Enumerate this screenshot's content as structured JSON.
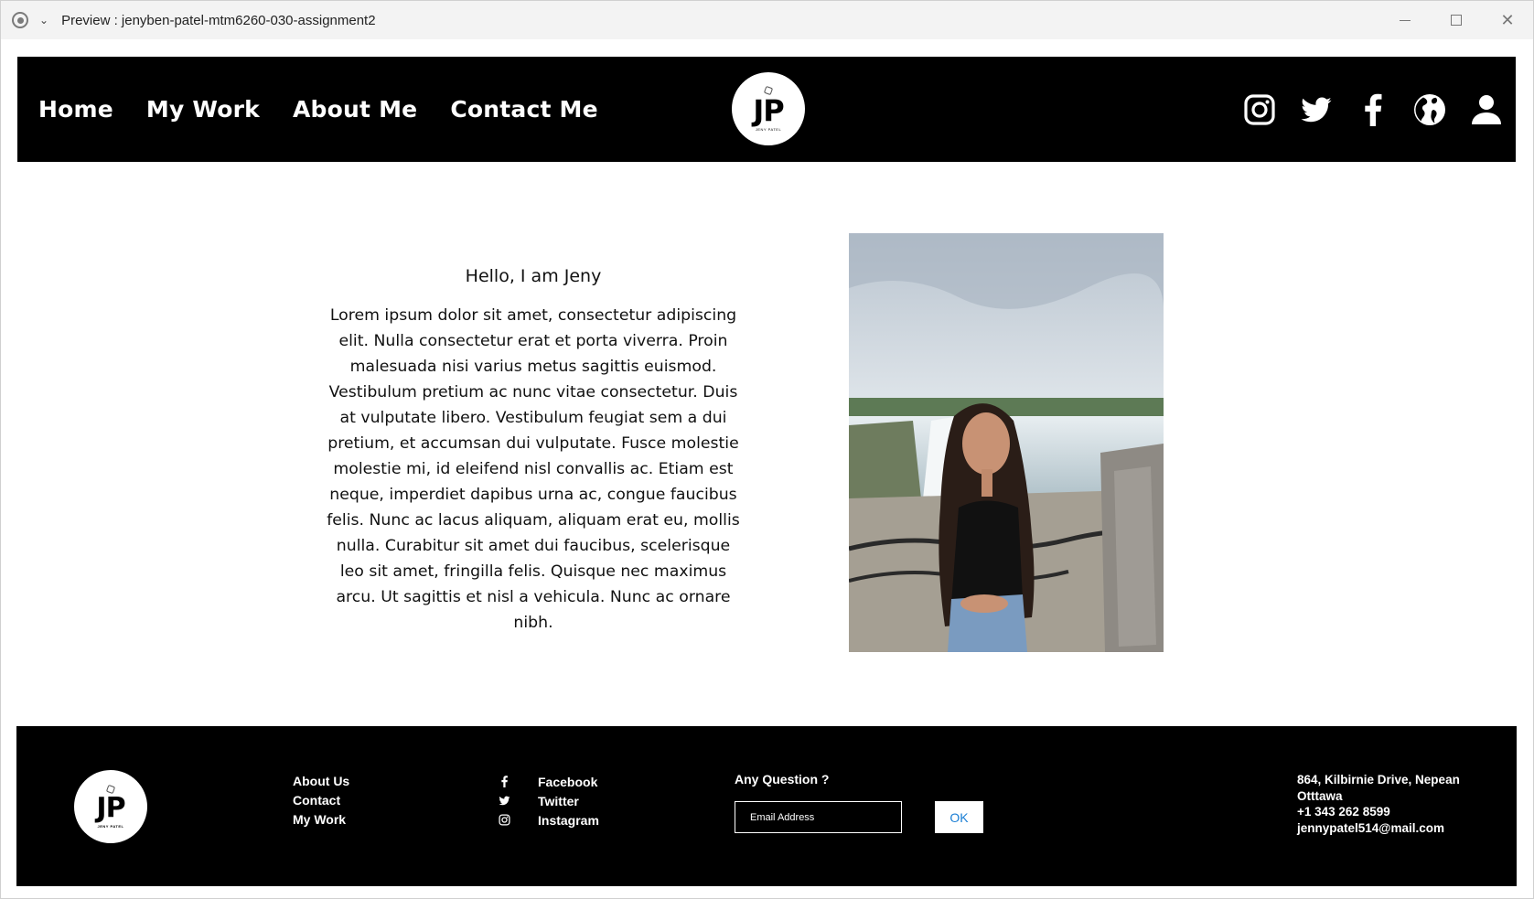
{
  "window": {
    "title": "Preview : jenyben-patel-mtm6260-030-assignment2"
  },
  "header": {
    "nav": [
      "Home",
      "My Work",
      "About Me",
      "Contact Me"
    ],
    "logo": {
      "initials": "JP",
      "subtitle": "JENY PATEL"
    },
    "social_icons": [
      "instagram-icon",
      "twitter-icon",
      "facebook-icon",
      "globe-icon",
      "user-icon"
    ]
  },
  "main": {
    "heading": "Hello, I am Jeny",
    "body": "Lorem ipsum dolor sit amet, consectetur adipiscing elit. Nulla consectetur erat et porta viverra. Proin malesuada nisi varius metus sagittis euismod. Vestibulum pretium ac nunc vitae consectetur. Duis at vulputate libero. Vestibulum feugiat sem a dui pretium, et accumsan dui vulputate. Fusce molestie molestie mi, id eleifend nisl convallis ac. Etiam est neque, imperdiet dapibus urna ac, congue faucibus felis. Nunc ac lacus aliquam, aliquam erat eu, mollis nulla. Curabitur sit amet dui faucibus, scelerisque leo sit amet, fringilla felis. Quisque nec maximus arcu. Ut sagittis et nisl a vehicula. Nunc ac ornare nibh."
  },
  "footer": {
    "logo": {
      "initials": "JP",
      "subtitle": "JENY PATEL"
    },
    "links": [
      "About Us",
      "Contact",
      "My Work"
    ],
    "social": [
      {
        "icon": "facebook-icon",
        "label": "Facebook"
      },
      {
        "icon": "twitter-icon",
        "label": "Twitter"
      },
      {
        "icon": "instagram-icon",
        "label": "Instagram"
      }
    ],
    "question": {
      "label": "Any Question ?",
      "placeholder": "Email Address",
      "button": "OK"
    },
    "address": {
      "line1": "864, Kilbirnie Drive, Nepean",
      "line2": "Otttawa",
      "phone": "+1 343 262 8599",
      "email": "jennypatel514@mail.com"
    }
  },
  "colors": {
    "header_bg": "#000000",
    "footer_bg": "#000000",
    "ok_button_text": "#1a7ed4"
  }
}
